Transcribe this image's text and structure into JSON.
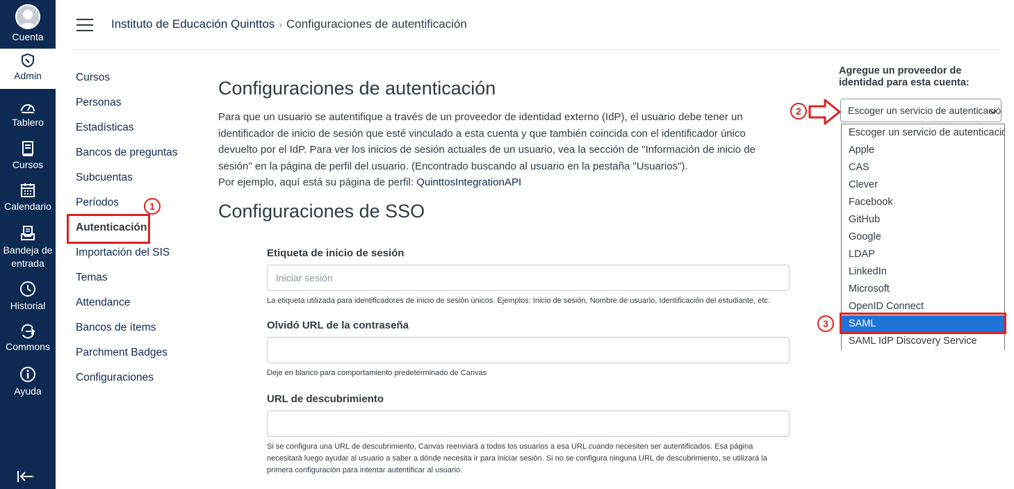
{
  "global_nav": {
    "items": [
      {
        "label": "Cuenta"
      },
      {
        "label": "Admin"
      },
      {
        "label": "Tablero"
      },
      {
        "label": "Cursos"
      },
      {
        "label": "Calendario"
      },
      {
        "label": "Bandeja de entrada"
      },
      {
        "label": "Historial"
      },
      {
        "label": "Commons"
      },
      {
        "label": "Ayuda"
      }
    ]
  },
  "breadcrumb": {
    "parent": "Instituto de Educación Quinttos",
    "current": "Configuraciones de autentificación"
  },
  "subnav": {
    "items": [
      "Cursos",
      "Personas",
      "Estadísticas",
      "Bancos de preguntas",
      "Subcuentas",
      "Períodos",
      "Autenticación",
      "Importación del SIS",
      "Temas",
      "Attendance",
      "Bancos de ítems",
      "Parchment Badges",
      "Configuraciones"
    ]
  },
  "main": {
    "title": "Configuraciones de autenticación",
    "description": "Para que un usuario se autentifique a través de un proveedor de identidad externo (IdP), el usuario debe tener un identificador de inicio de sesión que esté vinculado a esta cuenta y que también coincida con el identificador único devuelto por el IdP. Para ver los inicios de sesión actuales de un usuario, vea la sección de \"Información de inicio de sesión\" en la página de perfil del usuario. (Encontrado buscando al usuario en la pestaña \"Usuarios\").",
    "example_prefix": "Por ejemplo, aquí está su página de perfil: ",
    "example_link": "QuinttosIntegrationAPI",
    "sso_title": "Configuraciones de SSO",
    "fields": {
      "login_label": {
        "label": "Etiqueta de inicio de sesión",
        "placeholder": "Iniciar sesión",
        "help": "La etiqueta utilizada para identificadores de inicio de sesión únicos. Ejemplos: Inicio de sesión, Nombre de usuario, Identificación del estudiante, etc."
      },
      "forgot_url": {
        "label": "Olvidó URL de la contraseña",
        "placeholder": "",
        "help": "Deje en blanco para comportamiento predeterminado de Canvas"
      },
      "discovery_url": {
        "label": "URL de descubrimiento",
        "placeholder": "",
        "help": "Si se configura una URL de descubrimiento, Canvas reenviará a todos los usuarios a esa URL cuando necesiten ser autentificados. Esa página necesitará luego ayudar al usuario a saber a dónde necesita ir para iniciar sesión. Si no se configura ninguna URL de descubrimiento, se utilizará la primera configuración para intentar autentificar al usuario."
      }
    }
  },
  "identity_provider": {
    "label": "Agregue un proveedor de identidad para esta cuenta:",
    "selected": "Escoger un servicio de autenticación",
    "options": [
      "Escoger un servicio de autenticación",
      "Apple",
      "CAS",
      "Clever",
      "Facebook",
      "GitHub",
      "Google",
      "LDAP",
      "LinkedIn",
      "Microsoft",
      "OpenID Connect",
      "SAML",
      "SAML IdP Discovery Service"
    ],
    "highlighted_index": 11
  },
  "annotations": {
    "badge_1": "1",
    "badge_2": "2",
    "badge_3": "3",
    "color": "#e02020"
  },
  "colors": {
    "nav_bg": "#0e2a52",
    "link": "#0e2a52",
    "selection": "#1e73d8"
  }
}
